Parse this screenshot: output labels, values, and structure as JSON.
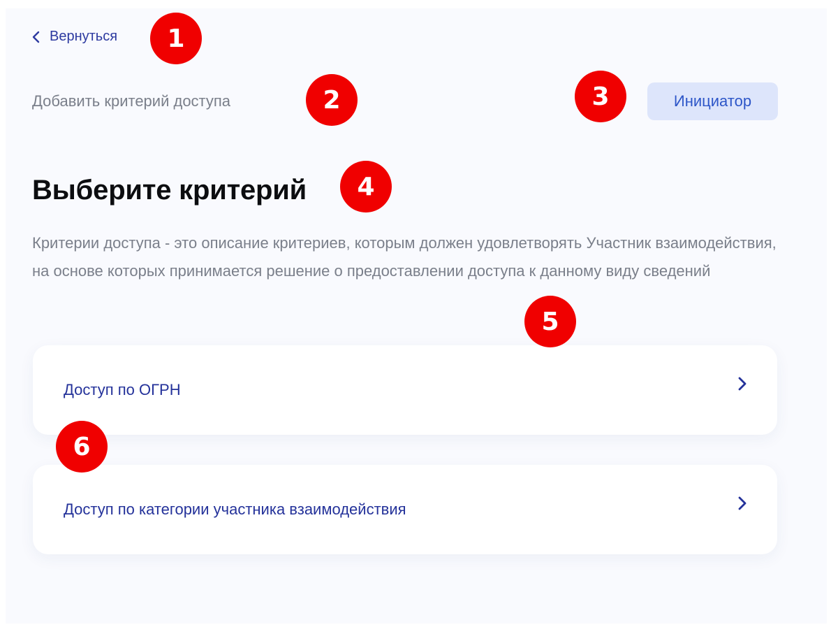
{
  "header": {
    "back_label": "Вернуться",
    "back_icon": "chevron-left-icon",
    "breadcrumb": "Добавить критерий доступа",
    "role_chip": "Инициатор"
  },
  "main": {
    "title": "Выберите критерий",
    "description": "Критерии доступа - это описание критериев, которым должен удовлетворять Участник взаимодействия, на основе которых принимается решение о предоставлении доступа к данному виду сведений",
    "options": [
      {
        "label": "Доступ по ОГРН",
        "icon": "chevron-right-icon"
      },
      {
        "label": "Доступ по категории участника взаимодействия",
        "icon": "chevron-right-icon"
      }
    ]
  },
  "annotations": [
    "1",
    "2",
    "3",
    "4",
    "5",
    "6"
  ],
  "colors": {
    "accent": "#2d3aa0",
    "chip_bg": "#dde5fb",
    "chip_text": "#2d56c8",
    "muted_text": "#7a7f8a",
    "marker": "#f00000",
    "page_bg": "#f9fafe"
  }
}
